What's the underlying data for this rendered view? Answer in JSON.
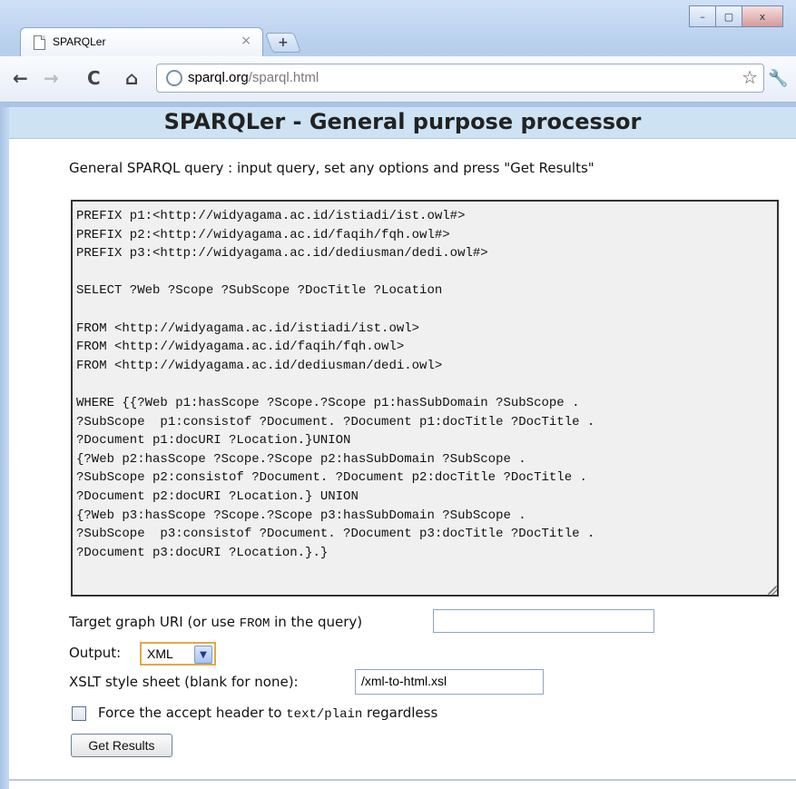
{
  "window": {
    "tab_title": "SPARQLer",
    "tab_close": "×",
    "new_tab": "+",
    "controls": {
      "minimize": "–",
      "maximize": "▢",
      "close": "x"
    }
  },
  "toolbar": {
    "back": "←",
    "forward": "→",
    "reload": "C",
    "home": "⌂",
    "url_host": "sparql.org",
    "url_path": "/sparql.html",
    "star": "☆",
    "wrench": "🔧"
  },
  "page": {
    "title": "SPARQLer - General purpose processor",
    "intro": "General SPARQL query : input query, set any options and press \"Get Results\"",
    "query_text": "PREFIX p1:<http://widyagama.ac.id/istiadi/ist.owl#>\nPREFIX p2:<http://widyagama.ac.id/faqih/fqh.owl#>\nPREFIX p3:<http://widyagama.ac.id/dediusman/dedi.owl#>\n\nSELECT ?Web ?Scope ?SubScope ?DocTitle ?Location\n\nFROM <http://widyagama.ac.id/istiadi/ist.owl>\nFROM <http://widyagama.ac.id/faqih/fqh.owl>\nFROM <http://widyagama.ac.id/dediusman/dedi.owl>\n\nWHERE {{?Web p1:hasScope ?Scope.?Scope p1:hasSubDomain ?SubScope .\n?SubScope  p1:consistof ?Document. ?Document p1:docTitle ?DocTitle .\n?Document p1:docURI ?Location.}UNION\n{?Web p2:hasScope ?Scope.?Scope p2:hasSubDomain ?SubScope .\n?SubScope p2:consistof ?Document. ?Document p2:docTitle ?DocTitle .\n?Document p2:docURI ?Location.} UNION\n{?Web p3:hasScope ?Scope.?Scope p3:hasSubDomain ?SubScope .\n?SubScope  p3:consistof ?Document. ?Document p3:docTitle ?DocTitle .\n?Document p3:docURI ?Location.}.}",
    "target_graph_label_pre": "Target graph URI (or use ",
    "target_graph_label_code": "FROM",
    "target_graph_label_post": " in the query)",
    "target_graph_value": "",
    "output_label": "Output:",
    "output_value": "XML",
    "xslt_label": "XSLT style sheet (blank for none):",
    "xslt_value": "/xml-to-html.xsl",
    "force_label_pre": "Force the accept header to ",
    "force_label_code": "text/plain",
    "force_label_post": " regardless",
    "force_checked": false,
    "submit_label": "Get Results"
  }
}
